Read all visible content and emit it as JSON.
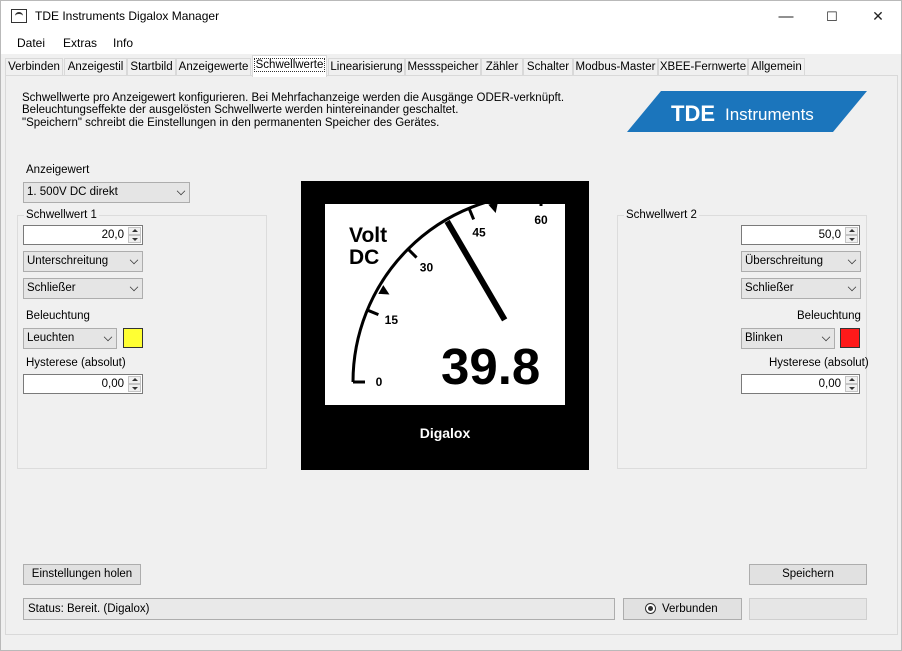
{
  "window": {
    "title": "TDE Instruments Digalox Manager",
    "minimize": "—",
    "maximize": "☐",
    "close": "✕"
  },
  "menu": [
    "Datei",
    "Extras",
    "Info"
  ],
  "tabs": [
    "Verbinden",
    "Anzeigestil",
    "Startbild",
    "Anzeigewerte",
    "Schwellwerte",
    "Linearisierung",
    "Messspeicher",
    "Zähler",
    "Schalter",
    "Modbus-Master",
    "XBEE-Fernwerte",
    "Allgemein"
  ],
  "active_tab": "Schwellwerte",
  "description": [
    "Schwellwerte pro Anzeigewert konfigurieren. Bei Mehrfachanzeige werden die Ausgänge ODER-verknüpft.",
    "Beleuchtungseffekte der ausgelösten Schwellwerte werden hintereinander geschaltet.",
    "\"Speichern\" schreibt die Einstellungen in den permanenten Speicher des Gerätes."
  ],
  "logo": {
    "brand": "TDE",
    "word": "Instruments",
    "color": "#1b75bc"
  },
  "anzeigewert": {
    "label": "Anzeigewert",
    "value": "1. 500V DC direkt"
  },
  "threshold1": {
    "group_label": "Schwellwert 1",
    "value": "20,0",
    "mode": "Unterschreitung",
    "contact": "Schließer",
    "lighting_label": "Beleuchtung",
    "lighting": "Leuchten",
    "color": "#ffff33",
    "hysteresis_label": "Hysterese (absolut)",
    "hysteresis": "0,00"
  },
  "threshold2": {
    "group_label": "Schwellwert 2",
    "value": "50,0",
    "mode": "Überschreitung",
    "contact": "Schließer",
    "lighting_label": "Beleuchtung",
    "lighting": "Blinken",
    "color": "#ff1a1a",
    "hysteresis_label": "Hysterese (absolut)",
    "hysteresis": "0,00"
  },
  "meter": {
    "unit_line1": "Volt",
    "unit_line2": "DC",
    "reading": "39.8",
    "brand": "Digalox",
    "scale_labels": [
      "0",
      "15",
      "30",
      "45",
      "60"
    ],
    "scale_min": 0,
    "scale_max": 60,
    "needle_value": 39.8,
    "marker_values": [
      20,
      50
    ]
  },
  "buttons": {
    "fetch": "Einstellungen holen",
    "save": "Speichern"
  },
  "status": {
    "text": "Status: Bereit. (Digalox)",
    "connected": "Verbunden"
  }
}
